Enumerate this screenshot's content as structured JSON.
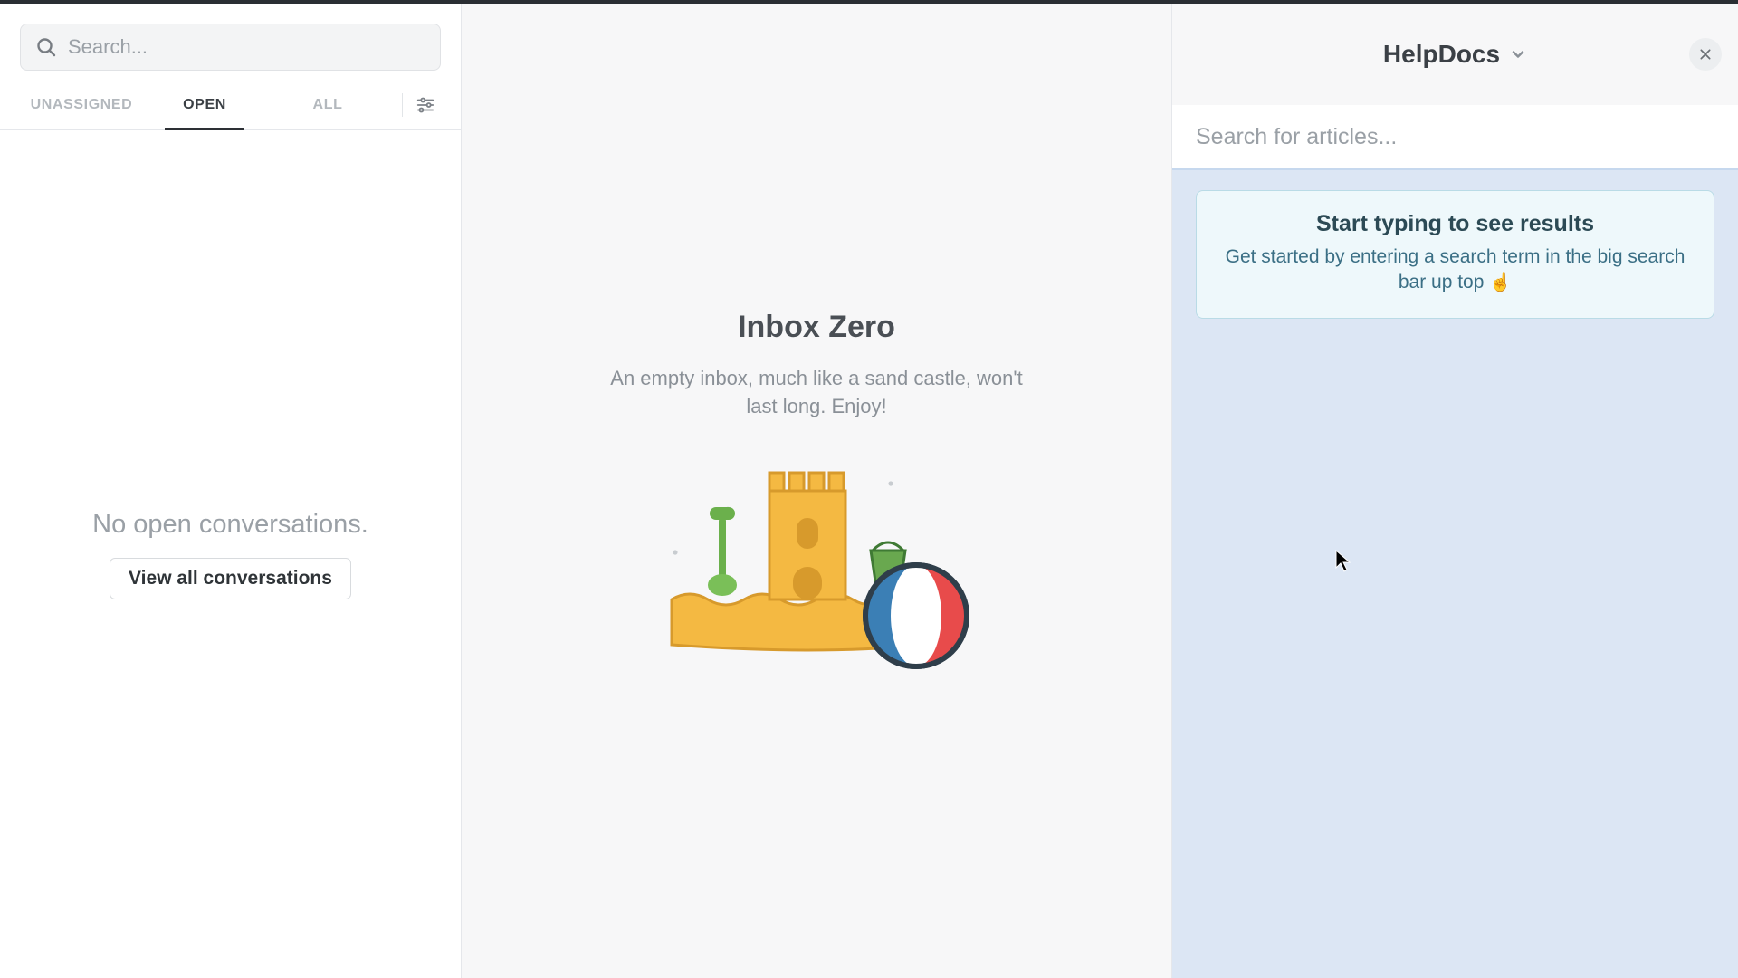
{
  "left": {
    "search_placeholder": "Search...",
    "tabs": {
      "unassigned": "UNASSIGNED",
      "open": "OPEN",
      "all": "ALL"
    },
    "empty_text": "No open conversations.",
    "view_all_label": "View all conversations"
  },
  "center": {
    "title": "Inbox Zero",
    "subtitle": "An empty inbox, much like a sand castle, won't last long. Enjoy!"
  },
  "right": {
    "title": "HelpDocs",
    "article_search_placeholder": "Search for articles...",
    "hint_title": "Start typing to see results",
    "hint_body": "Get started by entering a search term in the big search bar up top ",
    "hint_emoji": "☝️"
  },
  "colors": {
    "accent_sand": "#f4b942",
    "accent_blue": "#3b6f85",
    "panel_blue": "#dce6f4"
  }
}
